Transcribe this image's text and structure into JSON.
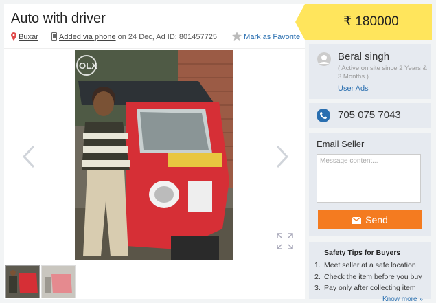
{
  "ad": {
    "title": "Auto with driver",
    "location": "Buxar",
    "added_via": "Added via phone",
    "added_on": "on 24 Dec, Ad ID: 801457725",
    "favorite": "Mark as Favorite"
  },
  "gallery": {
    "watermark": "OLX",
    "prev_icon": "chevron-left-icon",
    "next_icon": "chevron-right-icon",
    "expand_icon": "expand-icon",
    "thumbnail_count": 2
  },
  "price": {
    "text": "₹ 180000"
  },
  "seller": {
    "name": "Beral singh",
    "since": "( Active on site since 2 Years & 3 Months )",
    "ads_link": "User Ads"
  },
  "phone": {
    "number": "705 075 7043"
  },
  "email": {
    "title": "Email Seller",
    "placeholder": "Message content...",
    "send_label": "Send"
  },
  "tips": {
    "title": "Safety Tips for Buyers",
    "items": [
      {
        "n": "1.",
        "text": "Meet seller at a safe location"
      },
      {
        "n": "2.",
        "text": "Check the item before you buy"
      },
      {
        "n": "3.",
        "text": "Pay only after collecting item"
      }
    ],
    "more": "Know more »"
  },
  "colors": {
    "price_bg": "#ffe55c",
    "send_bg": "#f47b20",
    "link": "#2a6fb0",
    "phone_icon": "#2a6fb0",
    "pin_icon": "#e04848"
  }
}
